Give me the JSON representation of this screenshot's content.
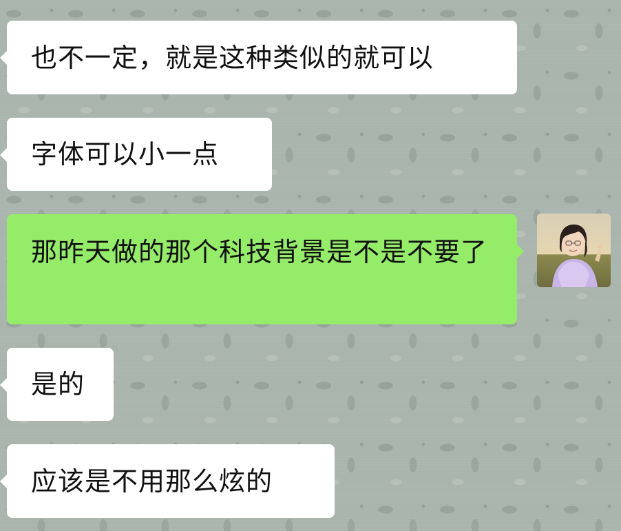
{
  "messages": [
    {
      "id": "m1",
      "side": "incoming",
      "text": "也不一定，就是这种类似的就可以"
    },
    {
      "id": "m2",
      "side": "incoming",
      "text": "字体可以小一点"
    },
    {
      "id": "m3",
      "side": "outgoing",
      "text": "那昨天做的那个科技背景是不是不要了"
    },
    {
      "id": "m4",
      "side": "incoming",
      "text": "是的"
    },
    {
      "id": "m5",
      "side": "incoming",
      "text": "应该是不用那么炫的"
    }
  ],
  "colors": {
    "incoming_bubble": "#ffffff",
    "outgoing_bubble": "#95ec69",
    "background": "#a9b4ad"
  },
  "icons": {
    "sender_avatar": "user-avatar-photo"
  }
}
